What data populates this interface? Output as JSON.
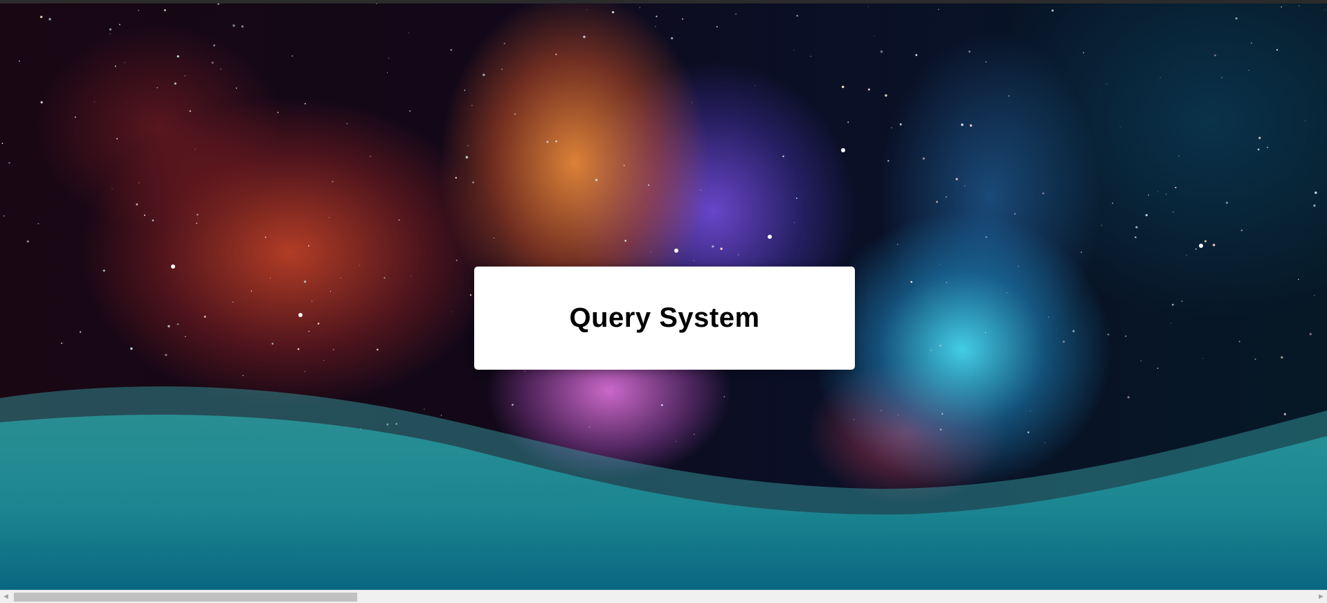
{
  "page": {
    "title": "Query System"
  },
  "theme": {
    "card_background": "#ffffff",
    "title_color": "#000000",
    "wave_colors": [
      "#1f8d93",
      "#0e6f86"
    ]
  },
  "scrollbar": {
    "left_arrow_icon": "chevron-left-icon",
    "right_arrow_icon": "chevron-right-icon",
    "left_arrow_glyph": "◀",
    "right_arrow_glyph": "▶"
  }
}
